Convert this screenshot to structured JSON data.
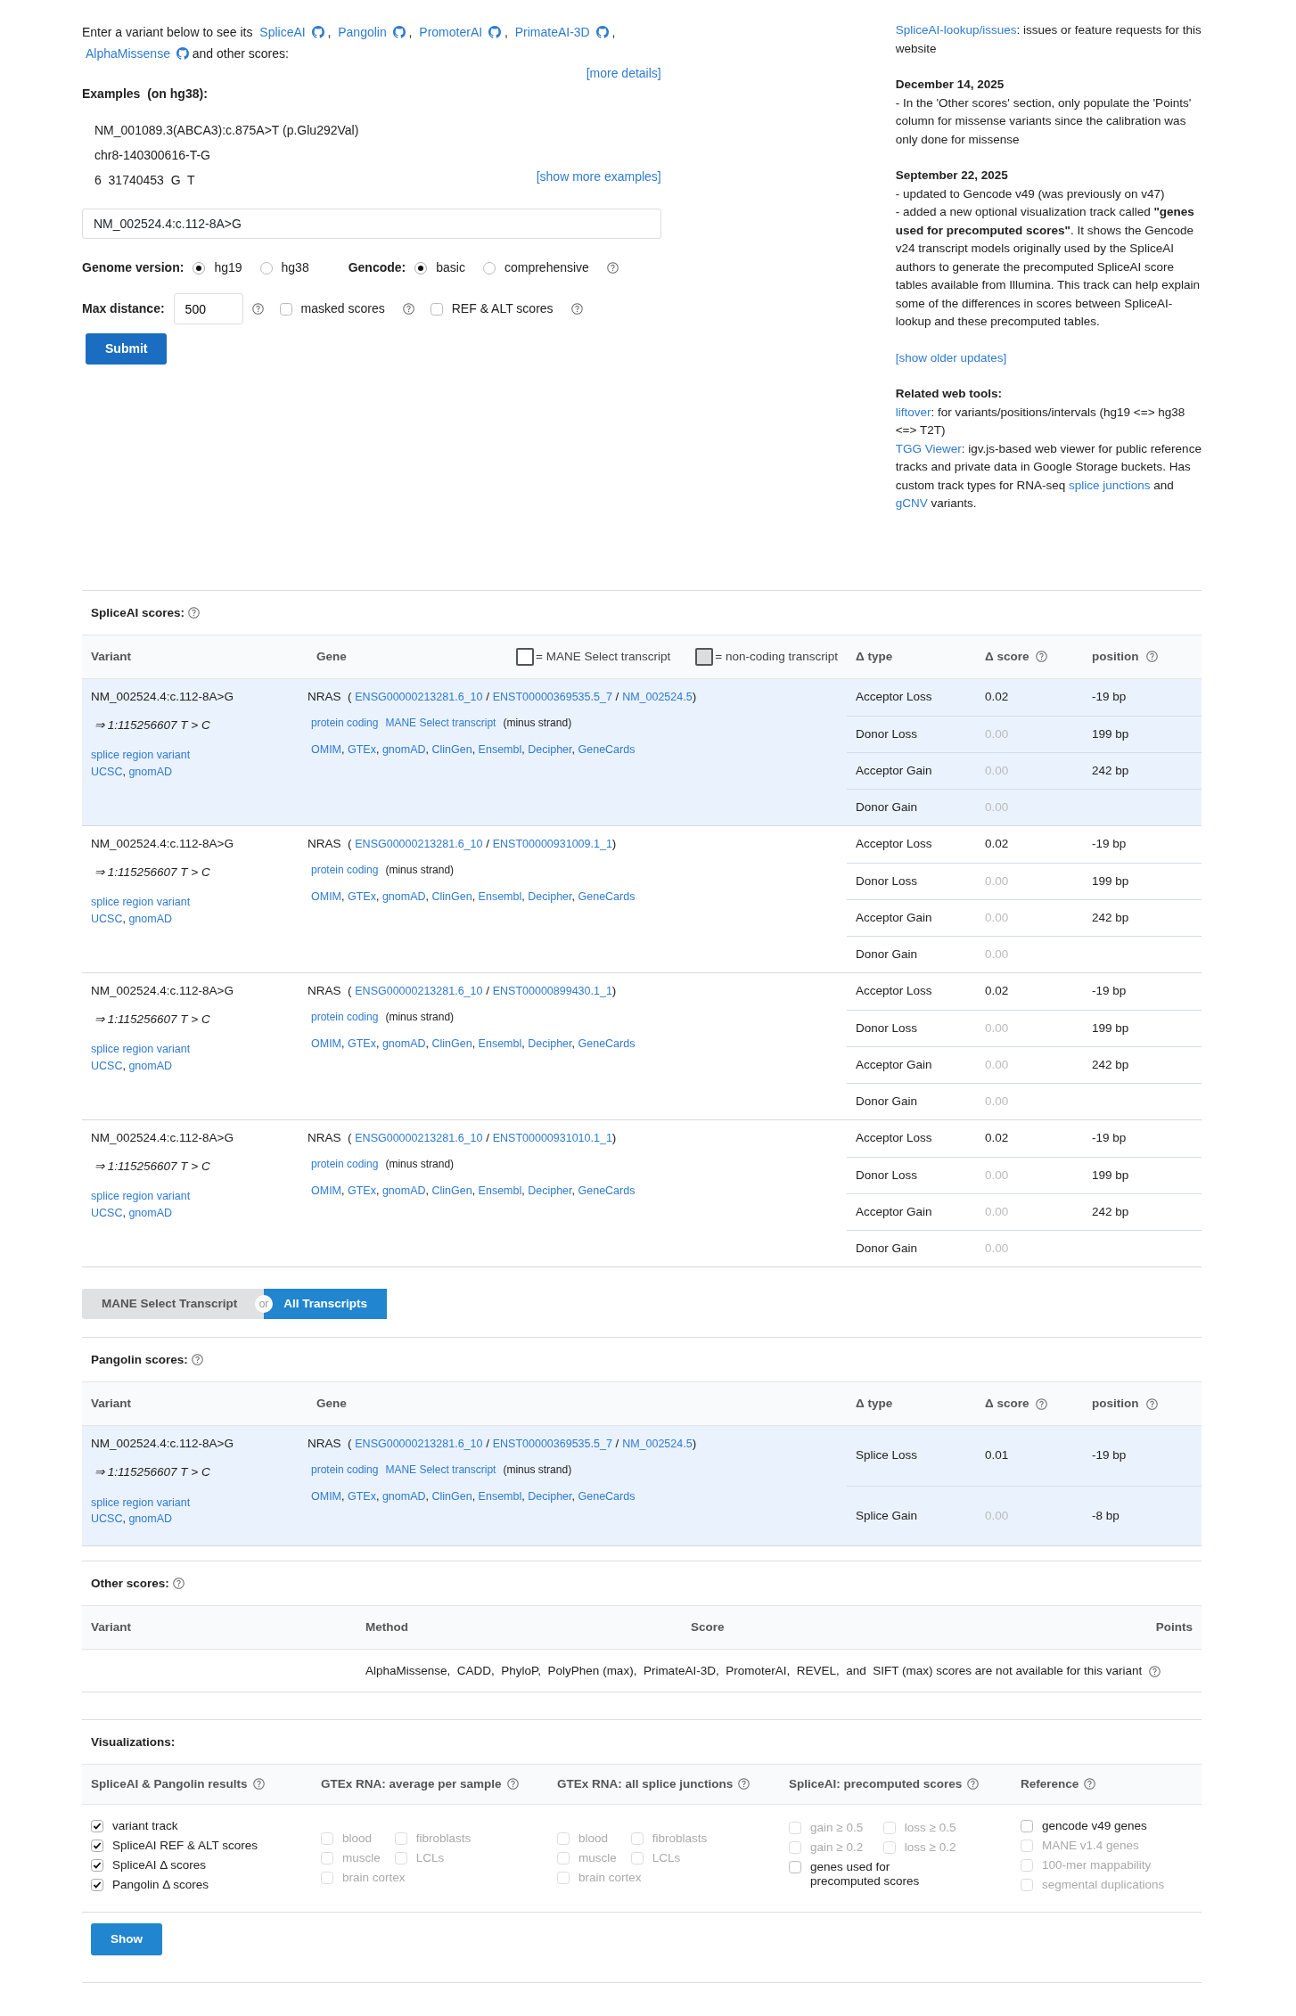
{
  "punct": {
    "open": "(",
    "close": ")",
    "slash": "/",
    "comma": ","
  },
  "intro": {
    "lead": "Enter a variant below to see its",
    "tools": [
      {
        "label": "SpliceAI",
        "after": ","
      },
      {
        "label": "Pangolin",
        "after": ","
      },
      {
        "label": "PromoterAI",
        "after": ","
      },
      {
        "label": "PrimateAI-3D",
        "after": ","
      },
      {
        "label": "AlphaMissense"
      }
    ],
    "tail": "and other scores:"
  },
  "more_details": "[more details]",
  "examples": {
    "title": "Examples  (on hg38):",
    "items": [
      "NM_001089.3(ABCA3):c.875A>T (p.Glu292Val)",
      "chr8-140300616-T-G",
      "6  31740453  G  T"
    ],
    "more": "[show more examples]"
  },
  "variant_input": {
    "value": "NM_002524.4:c.112-8A>G"
  },
  "genome": {
    "label": "Genome version:",
    "options": [
      {
        "label": "hg19",
        "selected": true
      },
      {
        "label": "hg38",
        "selected": false
      }
    ]
  },
  "gencode": {
    "label": "Gencode:",
    "options": [
      {
        "label": "basic",
        "selected": true
      },
      {
        "label": "comprehensive",
        "selected": false
      }
    ]
  },
  "max_distance": {
    "label": "Max distance:",
    "value": "500"
  },
  "options": [
    {
      "label": "masked scores",
      "checked": false
    },
    {
      "label": "REF & ALT scores",
      "checked": false
    }
  ],
  "submit": "Submit",
  "sidebar": [
    [
      {
        "kind": "text",
        "segments": [
          {
            "text": "SpliceAI-lookup/issues",
            "link": true
          },
          {
            "text": ": issues or feature requests for this website",
            "link": false
          }
        ]
      }
    ],
    [
      {
        "kind": "heading",
        "text": "December 14, 2025"
      },
      {
        "kind": "text",
        "segments": [
          {
            "text": "- In the 'Other scores' section, only populate the 'Points' column for missense variants since the calibration was only done for missense",
            "link": false
          }
        ]
      }
    ],
    [
      {
        "kind": "heading",
        "text": "September 22, 2025"
      },
      {
        "kind": "text",
        "segments": [
          {
            "text": "- updated to Gencode v49 (was previously on v47)",
            "link": false
          }
        ]
      },
      {
        "kind": "text",
        "segments": [
          {
            "text": "- added a new optional visualization track called **\"genes used for precomputed scores\"**. It shows the Gencode v24 transcript models originally used by the SpliceAI authors to generate the precomputed SpliceAI score tables available from Illumina. This track can help explain some of the differences in scores between SpliceAI-lookup and these precomputed tables.",
            "link": false
          }
        ]
      }
    ],
    [
      {
        "kind": "text",
        "segments": [
          {
            "text": "[show older updates]",
            "link": true
          }
        ]
      }
    ],
    [
      {
        "kind": "heading",
        "text": "Related web tools:"
      },
      {
        "kind": "text",
        "segments": [
          {
            "text": "liftover",
            "link": true
          },
          {
            "text": ": for variants/positions/intervals (hg19 <=> hg38 <=> T2T)",
            "link": false
          }
        ]
      },
      {
        "kind": "text",
        "segments": [
          {
            "text": "TGG Viewer",
            "link": true
          },
          {
            "text": ": igv.js-based web viewer for public reference tracks and private data in Google Storage buckets. Has custom track types for RNA-seq ",
            "link": false
          },
          {
            "text": "splice junctions",
            "link": true
          },
          {
            "text": " and ",
            "link": false
          },
          {
            "text": "gCNV",
            "link": true
          },
          {
            "text": " variants.",
            "link": false
          }
        ]
      }
    ]
  ],
  "spliceai": {
    "title": "SpliceAI scores:",
    "legend": [
      {
        "label": "= MANE Select transcript",
        "kind": "mane"
      },
      {
        "label": "= non-coding transcript",
        "kind": "noncoding"
      }
    ],
    "columns": [
      {
        "label": "Variant",
        "help": false
      },
      {
        "label": "Gene",
        "help": false
      },
      {
        "label": "Δ type",
        "help": false
      },
      {
        "label": "Δ score",
        "help": true
      },
      {
        "label": "position",
        "help": true
      }
    ],
    "rows": [
      {
        "highlighted": true,
        "variant": "NM_002524.4:c.112-8A>G",
        "position": "⇒ 1:115256607 T > C",
        "consequence": "splice region variant",
        "variant_links": [
          "UCSC",
          "gnomAD"
        ],
        "gene": "NRAS",
        "ids": [
          "ENSG00000213281.6_10",
          "ENST00000369535.5_7",
          "NM_002524.5"
        ],
        "tags": [
          {
            "text": "protein coding",
            "link": true
          },
          {
            "text": "MANE Select transcript",
            "link": true
          },
          {
            "text": "(minus strand)",
            "link": false
          }
        ],
        "links": [
          "OMIM",
          "GTEx",
          "gnomAD",
          "ClinGen",
          "Ensembl",
          "Decipher",
          "GeneCards"
        ],
        "scores": [
          {
            "type": "Acceptor Loss",
            "score": "0.02",
            "position": "-19 bp",
            "muted": false
          },
          {
            "type": "Donor Loss",
            "score": "0.00",
            "position": "199 bp",
            "muted": true
          },
          {
            "type": "Acceptor Gain",
            "score": "0.00",
            "position": "242 bp",
            "muted": true
          },
          {
            "type": "Donor Gain",
            "score": "0.00",
            "muted": true
          }
        ]
      },
      {
        "highlighted": false,
        "variant": "NM_002524.4:c.112-8A>G",
        "position": "⇒ 1:115256607 T > C",
        "consequence": "splice region variant",
        "variant_links": [
          "UCSC",
          "gnomAD"
        ],
        "gene": "NRAS",
        "ids": [
          "ENSG00000213281.6_10",
          "ENST00000931009.1_1"
        ],
        "tags": [
          {
            "text": "protein coding",
            "link": true
          },
          {
            "text": "(minus strand)",
            "link": false
          }
        ],
        "links": [
          "OMIM",
          "GTEx",
          "gnomAD",
          "ClinGen",
          "Ensembl",
          "Decipher",
          "GeneCards"
        ],
        "scores": [
          {
            "type": "Acceptor Loss",
            "score": "0.02",
            "position": "-19 bp",
            "muted": false
          },
          {
            "type": "Donor Loss",
            "score": "0.00",
            "position": "199 bp",
            "muted": true
          },
          {
            "type": "Acceptor Gain",
            "score": "0.00",
            "position": "242 bp",
            "muted": true
          },
          {
            "type": "Donor Gain",
            "score": "0.00",
            "muted": true
          }
        ]
      },
      {
        "highlighted": false,
        "variant": "NM_002524.4:c.112-8A>G",
        "position": "⇒ 1:115256607 T > C",
        "consequence": "splice region variant",
        "variant_links": [
          "UCSC",
          "gnomAD"
        ],
        "gene": "NRAS",
        "ids": [
          "ENSG00000213281.6_10",
          "ENST00000899430.1_1"
        ],
        "tags": [
          {
            "text": "protein coding",
            "link": true
          },
          {
            "text": "(minus strand)",
            "link": false
          }
        ],
        "links": [
          "OMIM",
          "GTEx",
          "gnomAD",
          "ClinGen",
          "Ensembl",
          "Decipher",
          "GeneCards"
        ],
        "scores": [
          {
            "type": "Acceptor Loss",
            "score": "0.02",
            "position": "-19 bp",
            "muted": false
          },
          {
            "type": "Donor Loss",
            "score": "0.00",
            "position": "199 bp",
            "muted": true
          },
          {
            "type": "Acceptor Gain",
            "score": "0.00",
            "position": "242 bp",
            "muted": true
          },
          {
            "type": "Donor Gain",
            "score": "0.00",
            "muted": true
          }
        ]
      },
      {
        "highlighted": false,
        "variant": "NM_002524.4:c.112-8A>G",
        "position": "⇒ 1:115256607 T > C",
        "consequence": "splice region variant",
        "variant_links": [
          "UCSC",
          "gnomAD"
        ],
        "gene": "NRAS",
        "ids": [
          "ENSG00000213281.6_10",
          "ENST00000931010.1_1"
        ],
        "tags": [
          {
            "text": "protein coding",
            "link": true
          },
          {
            "text": "(minus strand)",
            "link": false
          }
        ],
        "links": [
          "OMIM",
          "GTEx",
          "gnomAD",
          "ClinGen",
          "Ensembl",
          "Decipher",
          "GeneCards"
        ],
        "scores": [
          {
            "type": "Acceptor Loss",
            "score": "0.02",
            "position": "-19 bp",
            "muted": false
          },
          {
            "type": "Donor Loss",
            "score": "0.00",
            "position": "199 bp",
            "muted": true
          },
          {
            "type": "Acceptor Gain",
            "score": "0.00",
            "position": "242 bp",
            "muted": true
          },
          {
            "type": "Donor Gain",
            "score": "0.00",
            "muted": true
          }
        ]
      }
    ]
  },
  "toggle": {
    "options": [
      {
        "label": "MANE Select Transcript",
        "selected": false
      },
      {
        "label": "All Transcripts",
        "selected": true
      }
    ],
    "or": "or"
  },
  "pangolin": {
    "title": "Pangolin scores:",
    "columns": [
      {
        "label": "Variant",
        "help": false
      },
      {
        "label": "Gene",
        "help": false
      },
      {
        "label": "Δ type",
        "help": false
      },
      {
        "label": "Δ score",
        "help": true
      },
      {
        "label": "position",
        "help": true
      }
    ],
    "rows": [
      {
        "highlighted": true,
        "variant": "NM_002524.4:c.112-8A>G",
        "position": "⇒ 1:115256607 T > C",
        "consequence": "splice region variant",
        "variant_links": [
          "UCSC",
          "gnomAD"
        ],
        "gene": "NRAS",
        "ids": [
          "ENSG00000213281.6_10",
          "ENST00000369535.5_7",
          "NM_002524.5"
        ],
        "tags": [
          {
            "text": "protein coding",
            "link": true
          },
          {
            "text": "MANE Select transcript",
            "link": true
          },
          {
            "text": "(minus strand)",
            "link": false
          }
        ],
        "links": [
          "OMIM",
          "GTEx",
          "gnomAD",
          "ClinGen",
          "Ensembl",
          "Decipher",
          "GeneCards"
        ],
        "scores": [
          {
            "type": "Splice Loss",
            "score": "0.01",
            "position": "-19 bp",
            "muted": false
          },
          {
            "type": "Splice Gain",
            "score": "0.00",
            "position": "-8 bp",
            "muted": true
          }
        ]
      }
    ]
  },
  "other": {
    "title": "Other scores:",
    "columns": [
      "Variant",
      "Method",
      "Score",
      "Points"
    ],
    "message": "AlphaMissense,  CADD,  PhyloP,  PolyPhen (max),  PrimateAI-3D,  PromoterAI,  REVEL,  and  SIFT (max) scores are not available for this variant"
  },
  "visualizations": {
    "title": "Visualizations:",
    "groups": [
      {
        "title": "SpliceAI & Pangolin results",
        "options": [
          {
            "label": "variant track",
            "checked": true,
            "disabled": false
          },
          {
            "label": "SpliceAI REF & ALT scores",
            "checked": true,
            "disabled": false
          },
          {
            "label": "SpliceAI Δ scores",
            "checked": true,
            "disabled": false
          },
          {
            "label": "Pangolin Δ  scores",
            "checked": true,
            "disabled": false
          }
        ]
      },
      {
        "title": "GTEx RNA: average per sample",
        "options": [
          {
            "label": "blood",
            "checked": false,
            "disabled": true
          },
          {
            "label": "fibroblasts",
            "checked": false,
            "disabled": true
          },
          {
            "label": "muscle",
            "checked": false,
            "disabled": true
          },
          {
            "label": "LCLs",
            "checked": false,
            "disabled": true
          },
          {
            "label": "brain cortex",
            "checked": false,
            "disabled": true
          }
        ]
      },
      {
        "title": "GTEx RNA: all splice junctions",
        "options": [
          {
            "label": "blood",
            "checked": false,
            "disabled": true
          },
          {
            "label": "fibroblasts",
            "checked": false,
            "disabled": true
          },
          {
            "label": "muscle",
            "checked": false,
            "disabled": true
          },
          {
            "label": "LCLs",
            "checked": false,
            "disabled": true
          },
          {
            "label": "brain cortex",
            "checked": false,
            "disabled": true
          }
        ]
      },
      {
        "title": "SpliceAI: precomputed scores",
        "options": [
          {
            "label": "gain ≥ 0.5",
            "checked": false,
            "disabled": true
          },
          {
            "label": "loss ≥ 0.5",
            "checked": false,
            "disabled": true
          },
          {
            "label": "gain ≥ 0.2",
            "checked": false,
            "disabled": true
          },
          {
            "label": "loss ≥ 0.2",
            "checked": false,
            "disabled": true
          },
          {
            "label": "genes used for precomputed scores",
            "checked": false,
            "disabled": false
          }
        ]
      },
      {
        "title": "Reference",
        "options": [
          {
            "label": "gencode v49 genes",
            "checked": false,
            "disabled": false
          },
          {
            "label": "MANE v1.4 genes",
            "checked": false,
            "disabled": true
          },
          {
            "label": "100-mer mappability",
            "checked": false,
            "disabled": true
          },
          {
            "label": "segmental duplications",
            "checked": false,
            "disabled": true
          }
        ]
      }
    ],
    "show": "Show"
  }
}
